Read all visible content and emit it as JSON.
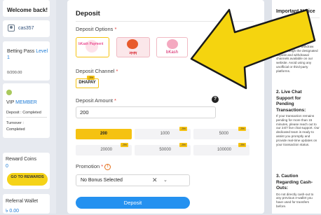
{
  "sidebar": {
    "welcome": "Welcome back!",
    "username": "cas357",
    "betting_pass_label": "Betting Pass",
    "betting_pass_level": "Level 1",
    "betting_pass_progress": "0/200.00",
    "vip_label": "VIP",
    "vip_member": "MEMBER",
    "deposit_status": "Deposit : Completed",
    "turnover_label": "Turnover :",
    "turnover_status": "Completed",
    "reward_coins_label": "Reward Coins",
    "reward_coins_value": "0",
    "go_to_rewards": "GO TO REWARDS",
    "referral_wallet_label": "Referral Wallet",
    "referral_wallet_value": "৳ 0.00"
  },
  "deposit": {
    "title": "Deposit",
    "options_label": "Deposit Options",
    "options": [
      {
        "name": "bKash Payment",
        "selected": true
      },
      {
        "name": "নগদ",
        "selected": false
      },
      {
        "name": "bKash",
        "selected": false
      }
    ],
    "channel_label": "Deposit Channel",
    "channel_value": "DHAPAY",
    "channel_badge": "-3%",
    "amount_label": "Deposit Amount",
    "amount_value": "200",
    "help_icon": "?",
    "chips": [
      {
        "label": "200",
        "badge": ""
      },
      {
        "label": "1000",
        "badge": "-3%"
      },
      {
        "label": "5000",
        "badge": "-3%"
      },
      {
        "label": "20000",
        "badge": "-3%"
      },
      {
        "label": "50000",
        "badge": "-3%"
      },
      {
        "label": "100000",
        "badge": "-3%"
      }
    ],
    "promotion_label": "Promotion",
    "promotion_value": "No Bonus Selected",
    "clear_icon": "✕",
    "dropdown_icon": "⌄",
    "submit_label": "Deposit"
  },
  "notice": {
    "title": "Important Notice",
    "sections": [
      {
        "heading": "1. Use Official Deposit & Withdrawal Channels Only:",
        "body": "Kindly deposit or withdraw funds through the designated deposit and withdrawal channels available on our website. Avoid using any unofficial or third-party platforms."
      },
      {
        "heading": "2. Live Chat Support for Pending Transactions:",
        "body": "If your transaction remains pending for more than 15 minutes, please reach out to our 24/7 live chat support. Our dedicated team is ready to assist you promptly and provide real-time updates on your transaction status."
      },
      {
        "heading": "3. Caution Regarding Cash-Outs:",
        "body": "Do not directly cash-out to any previous e-wallet you have used for transfers before."
      }
    ]
  },
  "colors": {
    "accent_yellow": "#f5c211",
    "button_blue": "#2491f0",
    "link_blue": "#1e7bd6",
    "required_red": "#e53935"
  }
}
